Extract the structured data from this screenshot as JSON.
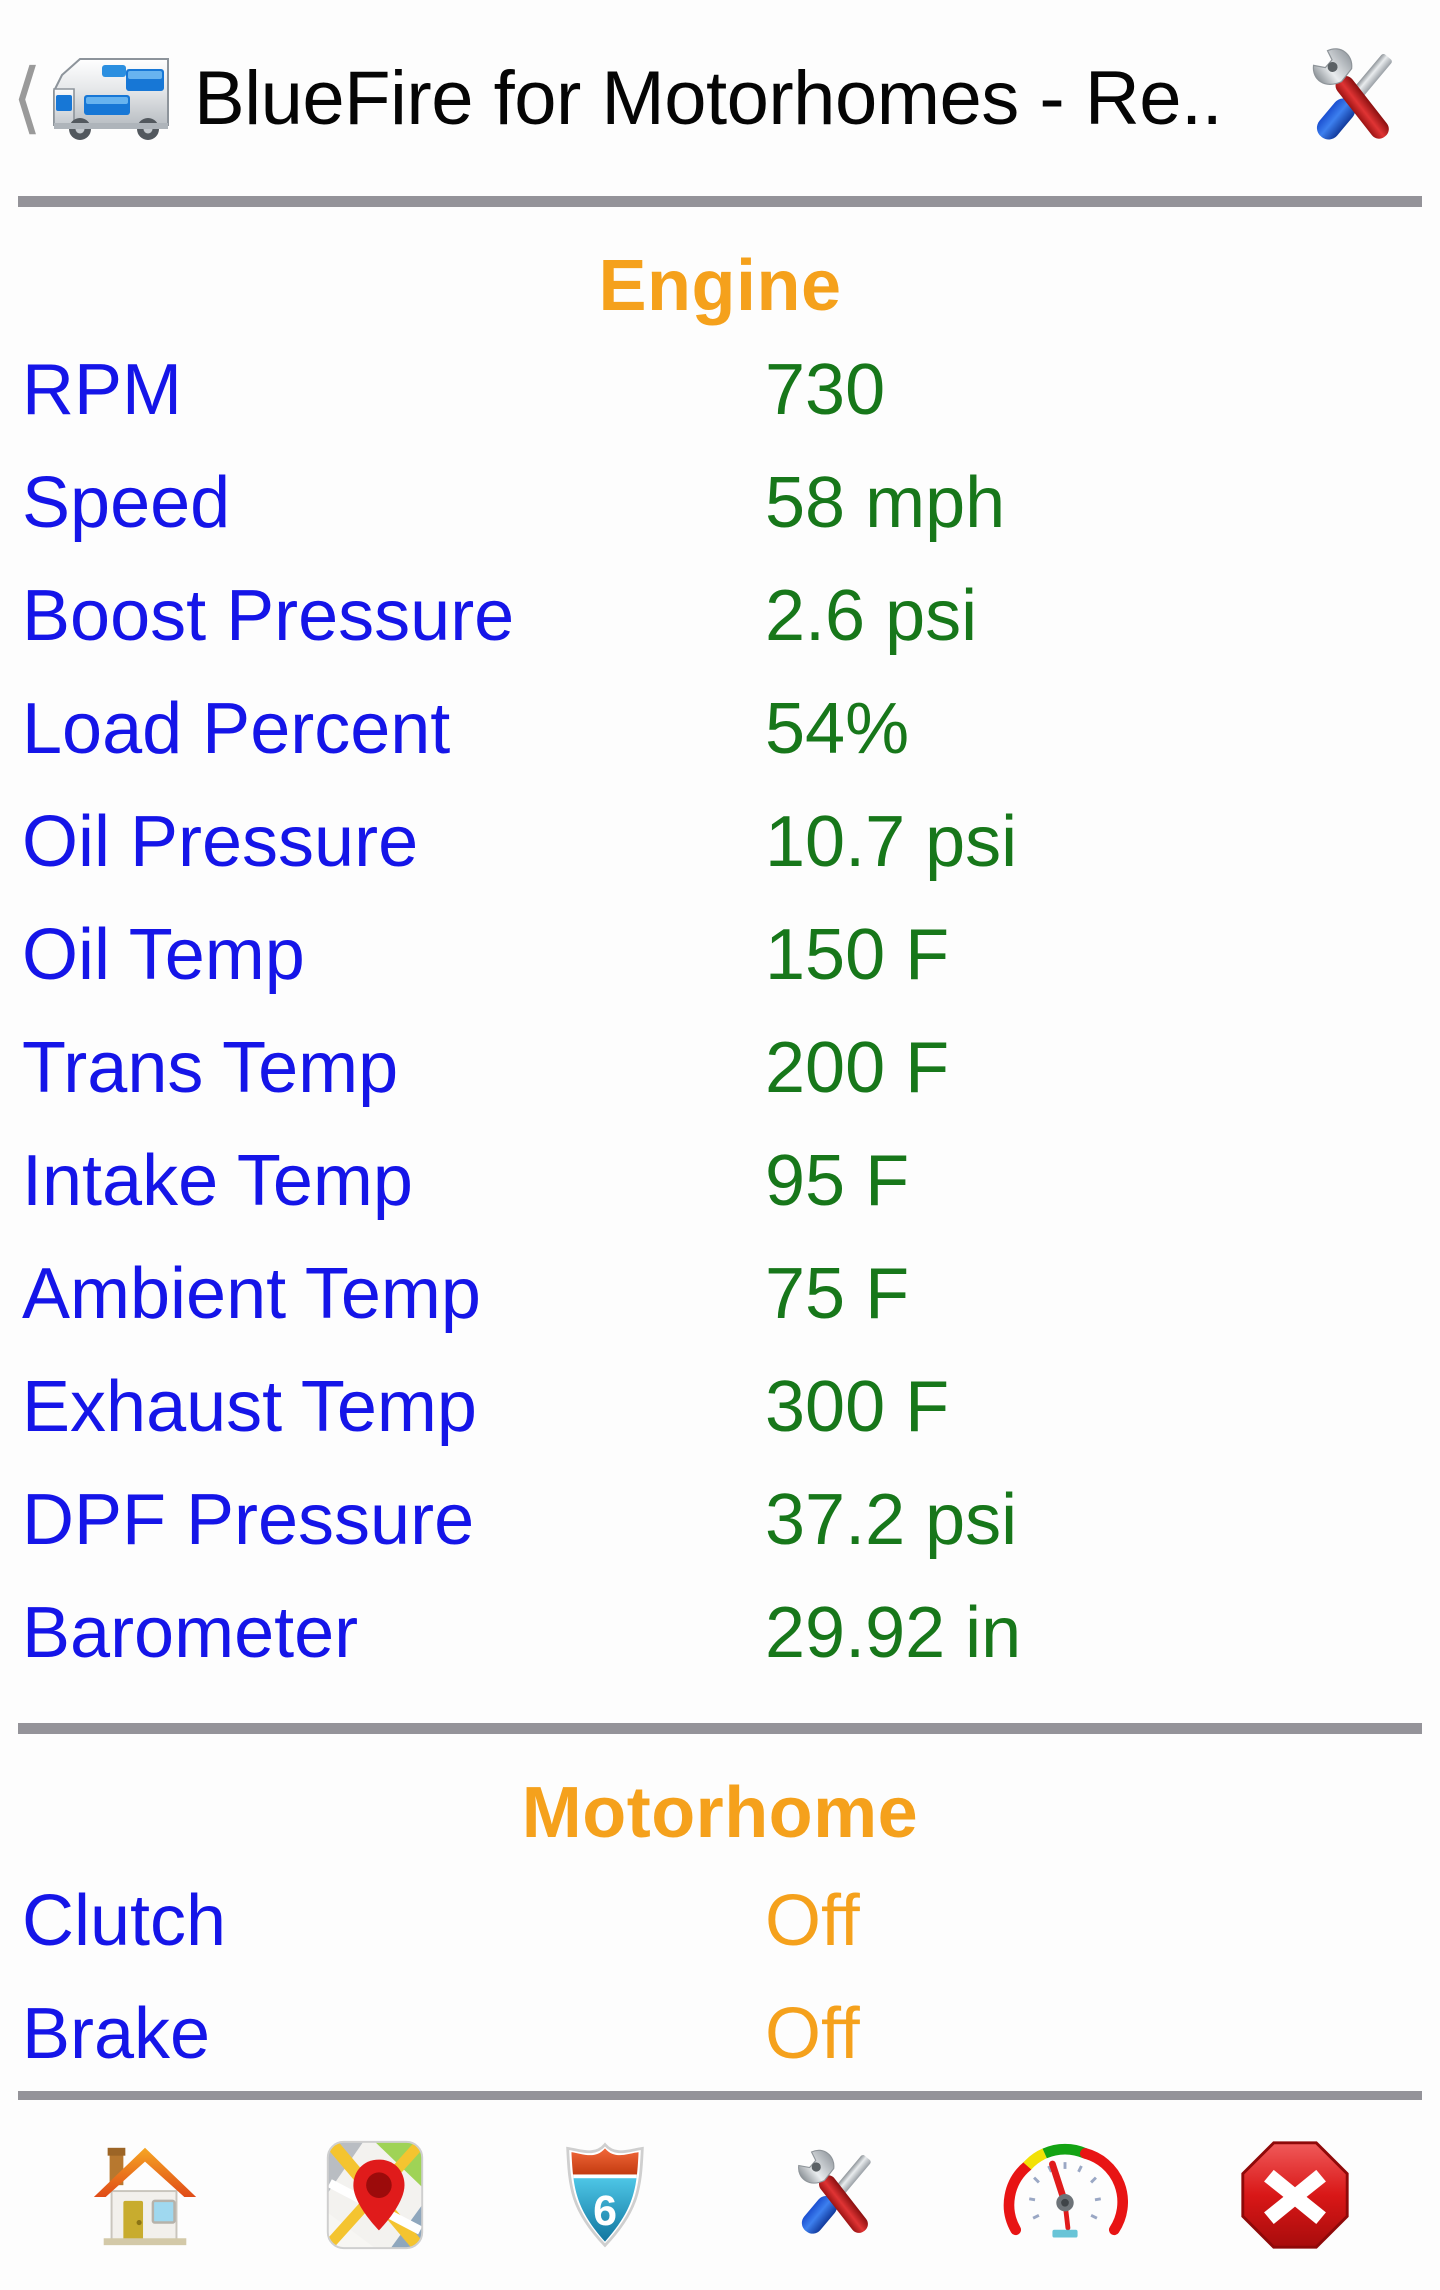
{
  "titlebar": {
    "back_icon": "back-chevron-icon",
    "app_icon": "motorhome-icon",
    "title": "BlueFire for Motorhomes - Re..",
    "action_icon": "tools-icon"
  },
  "colors": {
    "label": "#1515e8",
    "value_green": "#17771a",
    "accent_orange": "#f5a11c",
    "divider": "#949399",
    "background": "#fdfdfd",
    "title_text": "#050505"
  },
  "sections": [
    {
      "title": "Engine",
      "rows": [
        {
          "label": "RPM",
          "value": "730",
          "state": "green"
        },
        {
          "label": "Speed",
          "value": "58 mph",
          "state": "green"
        },
        {
          "label": "Boost Pressure",
          "value": "2.6 psi",
          "state": "green"
        },
        {
          "label": "Load Percent",
          "value": "54%",
          "state": "green"
        },
        {
          "label": "Oil Pressure",
          "value": "10.7 psi",
          "state": "green"
        },
        {
          "label": "Oil Temp",
          "value": "150 F",
          "state": "green"
        },
        {
          "label": "Trans Temp",
          "value": "200 F",
          "state": "green"
        },
        {
          "label": "Intake Temp",
          "value": "95 F",
          "state": "green"
        },
        {
          "label": "Ambient Temp",
          "value": "75 F",
          "state": "green"
        },
        {
          "label": "Exhaust Temp",
          "value": "300 F",
          "state": "green"
        },
        {
          "label": "DPF Pressure",
          "value": "37.2 psi",
          "state": "green"
        },
        {
          "label": "Barometer",
          "value": "29.92 in",
          "state": "green"
        }
      ]
    },
    {
      "title": "Motorhome",
      "rows": [
        {
          "label": "Clutch",
          "value": "Off",
          "state": "orange"
        },
        {
          "label": "Brake",
          "value": "Off",
          "state": "orange"
        }
      ]
    }
  ],
  "navbar": {
    "items": [
      {
        "name": "home-icon",
        "label": "Home"
      },
      {
        "name": "map-icon",
        "label": "Map"
      },
      {
        "name": "highway-shield-icon",
        "label": "6"
      },
      {
        "name": "tools-icon",
        "label": "Tools"
      },
      {
        "name": "gauge-icon",
        "label": "Gauges"
      },
      {
        "name": "stop-icon",
        "label": "Exit"
      }
    ]
  }
}
